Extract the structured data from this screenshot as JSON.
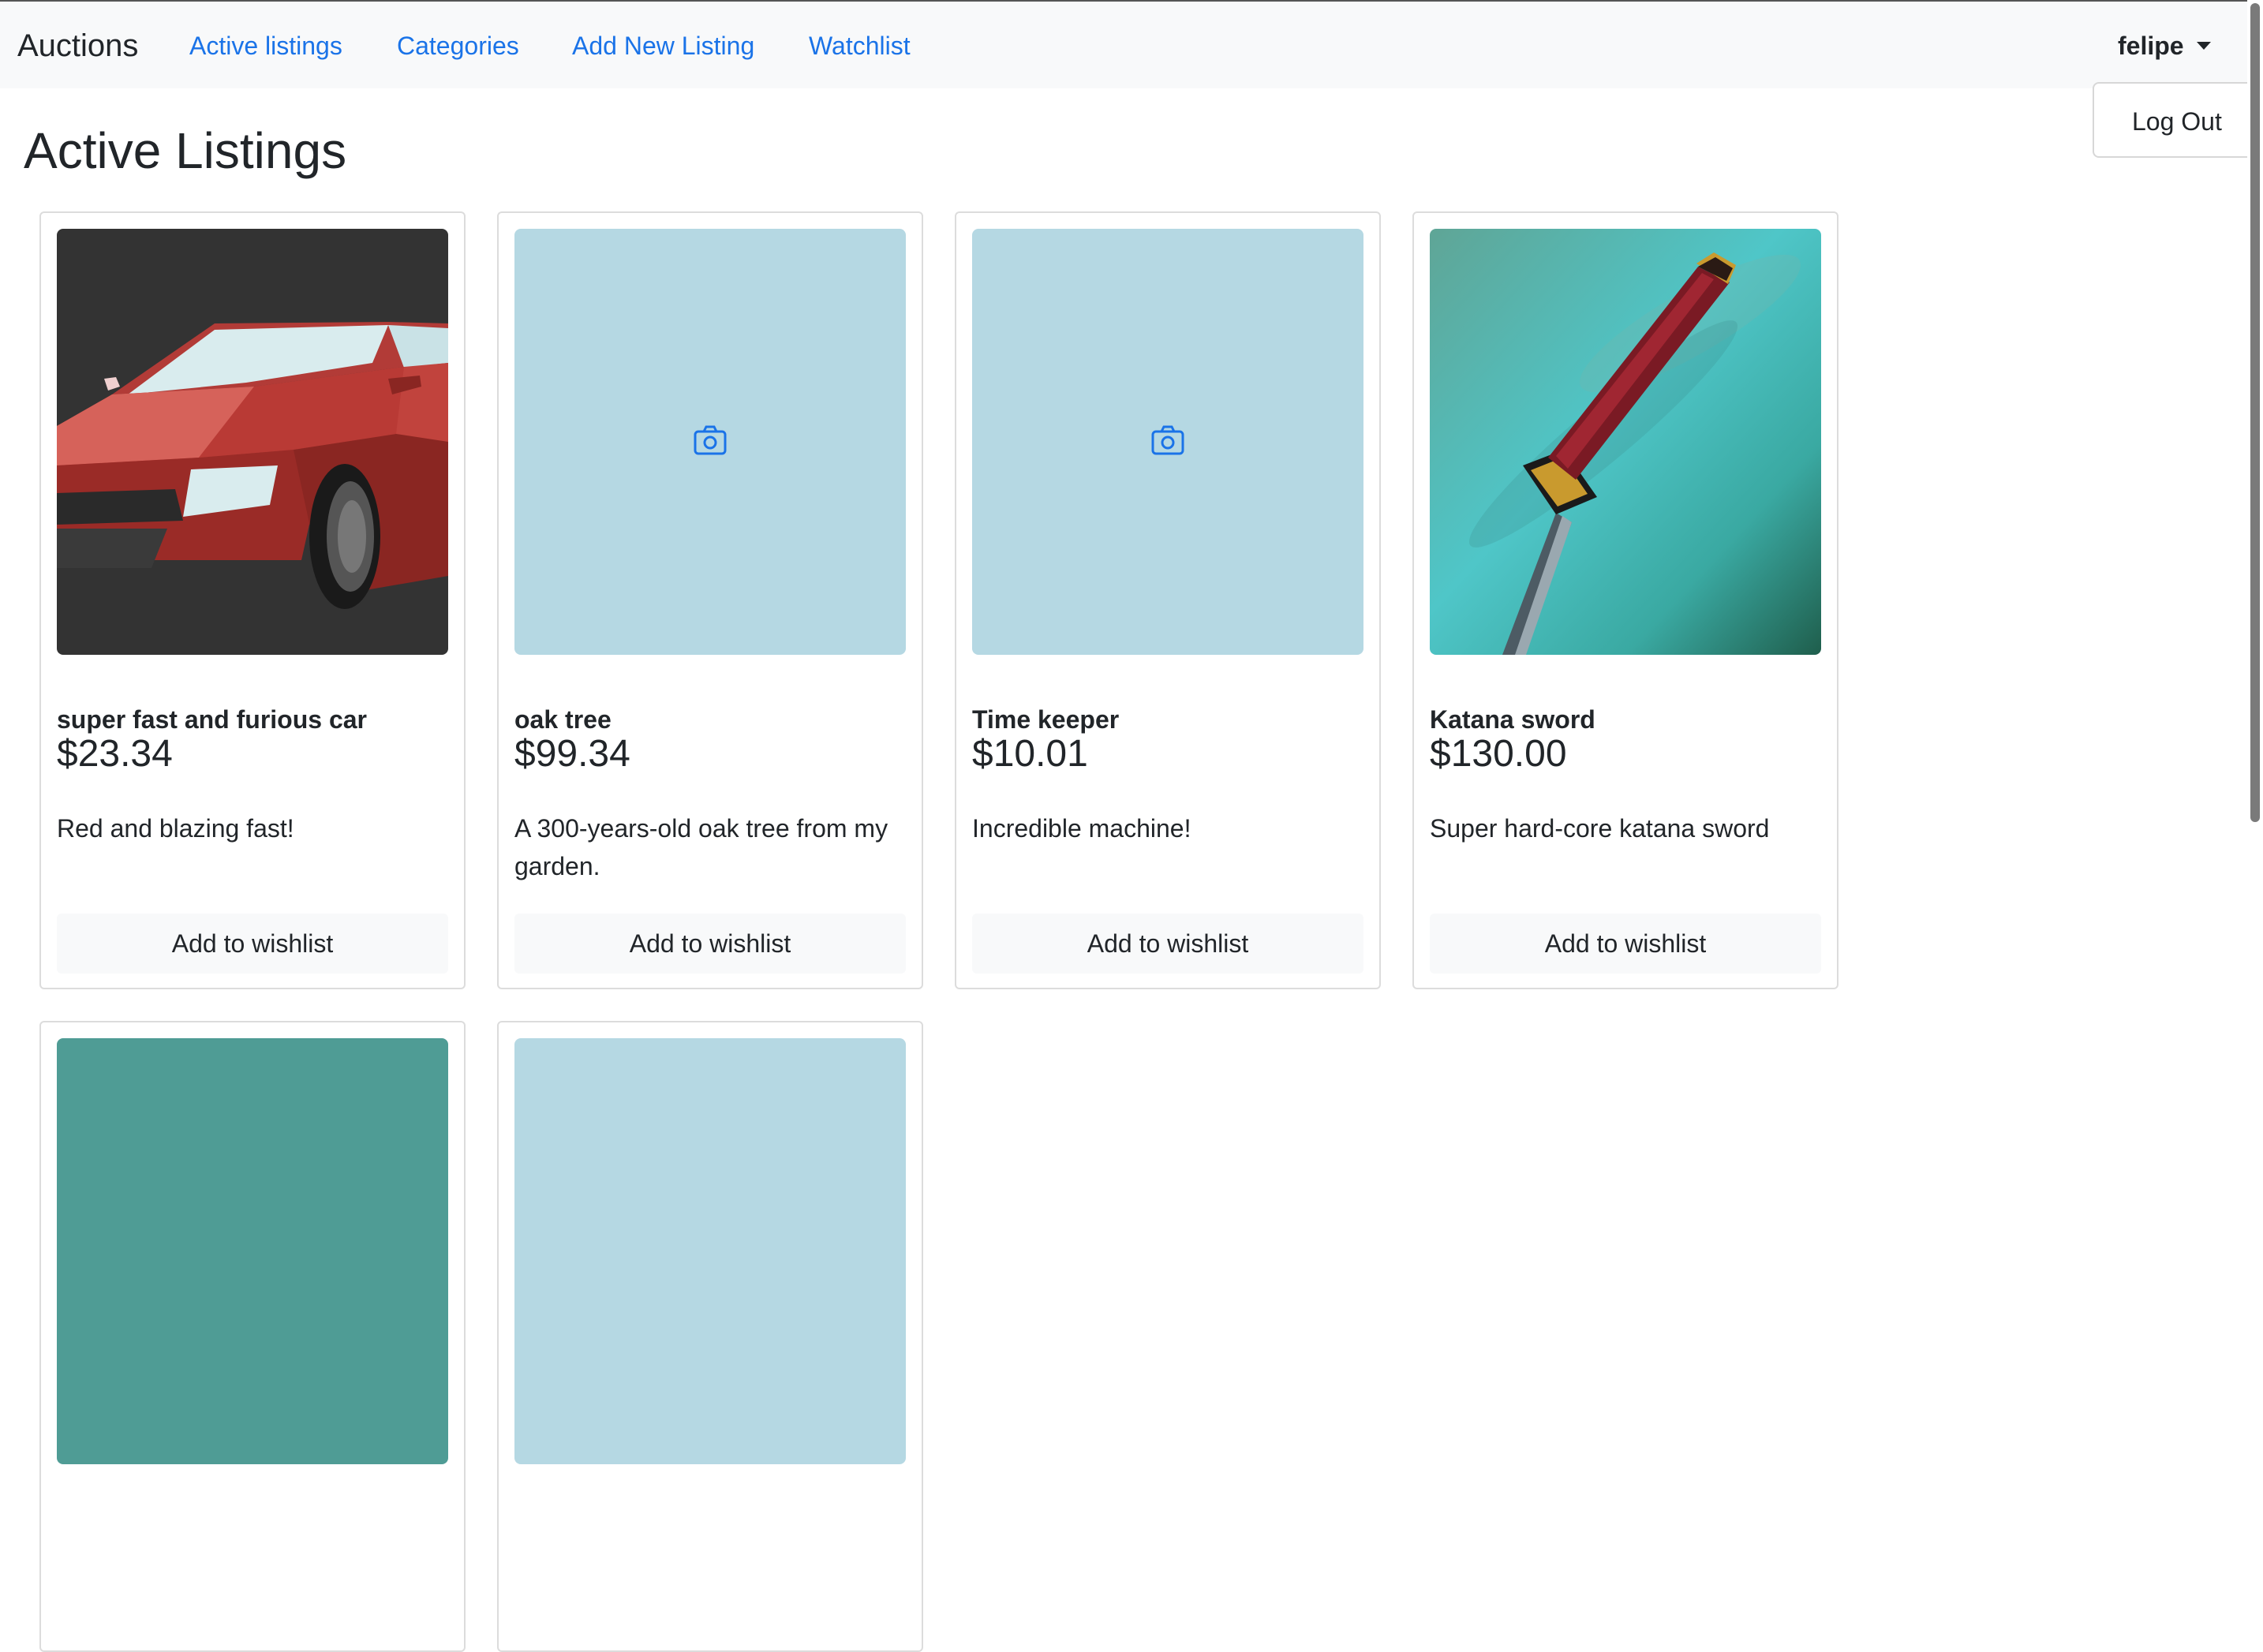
{
  "navbar": {
    "brand": "Auctions",
    "links": [
      "Active listings",
      "Categories",
      "Add New Listing",
      "Watchlist"
    ],
    "user": "felipe",
    "dropdown": [
      "Log Out"
    ]
  },
  "page": {
    "title": "Active Listings"
  },
  "listings": [
    {
      "title": "super fast and furious car",
      "price": "$23.34",
      "description": "Red and blazing fast!",
      "button": "Add to wishlist",
      "image": "red-car-image"
    },
    {
      "title": "oak tree",
      "price": "$99.34",
      "description": "A 300-years-old oak tree from my garden.",
      "button": "Add to wishlist",
      "image": "camera-placeholder-icon"
    },
    {
      "title": "Time keeper",
      "price": "$10.01",
      "description": "Incredible machine!",
      "button": "Add to wishlist",
      "image": "camera-placeholder-icon"
    },
    {
      "title": "Katana sword",
      "price": "$130.00",
      "description": "Super hard-core katana sword",
      "button": "Add to wishlist",
      "image": "katana-image"
    }
  ],
  "colors": {
    "link": "#1a73e8",
    "navbar_bg": "#f8f9fa",
    "placeholder_bg": "#b5d8e3",
    "button_bg": "#f8f9fa"
  }
}
